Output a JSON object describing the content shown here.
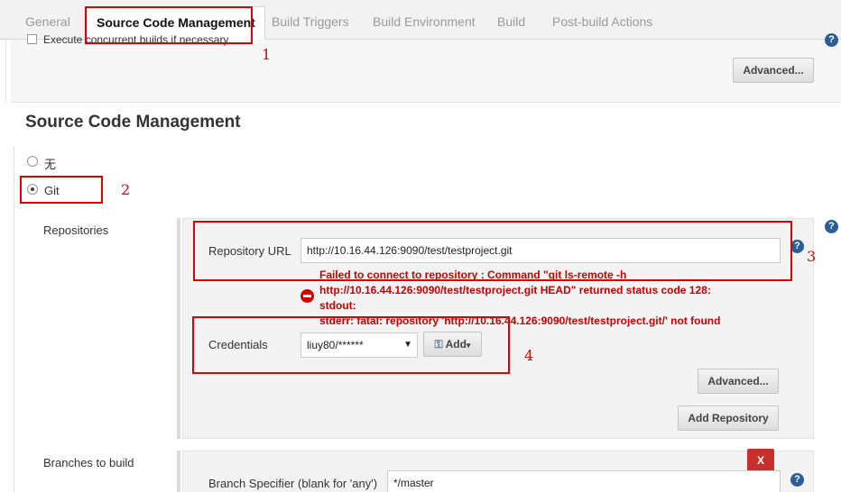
{
  "tabs": [
    {
      "label": "General"
    },
    {
      "label": "Source Code Management"
    },
    {
      "label": "Build Triggers"
    },
    {
      "label": "Build Environment"
    },
    {
      "label": "Build"
    },
    {
      "label": "Post-build Actions"
    }
  ],
  "general": {
    "concurrent_label": "Execute concurrent builds if necessary",
    "advanced_label": "Advanced..."
  },
  "scm": {
    "heading": "Source Code Management",
    "options": [
      {
        "label": "无",
        "checked": false
      },
      {
        "label": "Git",
        "checked": true
      }
    ],
    "repositories_label": "Repositories",
    "repo_url_label": "Repository URL",
    "repo_url_value": "http://10.16.44.126:9090/test/testproject.git",
    "error": {
      "line1": "Failed to connect to repository : Command \"git ls-remote -h",
      "line2": "http://10.16.44.126:9090/test/testproject.git HEAD\" returned status code 128:",
      "line3": "stdout:",
      "line4": "stderr: fatal: repository 'http://10.16.44.126:9090/test/testproject.git/' not found"
    },
    "credentials_label": "Credentials",
    "credentials_value": "liuy80/******",
    "add_label": "Add",
    "advanced_label": "Advanced...",
    "add_repository_label": "Add Repository",
    "branches_label": "Branches to build",
    "branch_specifier_label": "Branch Specifier (blank for 'any')",
    "branch_specifier_value": "*/master",
    "delete_label": "X"
  },
  "annotations": [
    "1",
    "2",
    "3",
    "4"
  ],
  "colors": {
    "annotation": "#e00000",
    "error": "#cc0000",
    "help_icon": "#2d5d96",
    "delete_button": "#c9302c"
  }
}
